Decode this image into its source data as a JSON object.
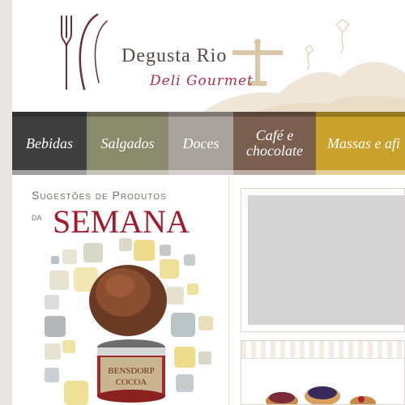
{
  "brand": {
    "name": "Degusta Rio",
    "tagline": "Deli Gourmet"
  },
  "nav": {
    "items": [
      {
        "label": "Bebidas",
        "color": "#3c3c3c"
      },
      {
        "label": "Salgados",
        "color": "#8a8a6c"
      },
      {
        "label": "Doces",
        "color": "#a7a29b"
      },
      {
        "label": "Café e chocolate",
        "color": "#7a5e50"
      },
      {
        "label": "Massas e afi",
        "color": "#c8a22c"
      }
    ]
  },
  "promo": {
    "heading_line1": "Sugestões de Produtos",
    "heading_da": "da",
    "heading_semana": "SEMANA",
    "product_label_brand": "BENSDORP",
    "product_label_name": "COCOA"
  },
  "colors": {
    "brand_red": "#a01a2a",
    "logo_text": "#5a4a45",
    "tagline_pink": "#b22d4a"
  }
}
